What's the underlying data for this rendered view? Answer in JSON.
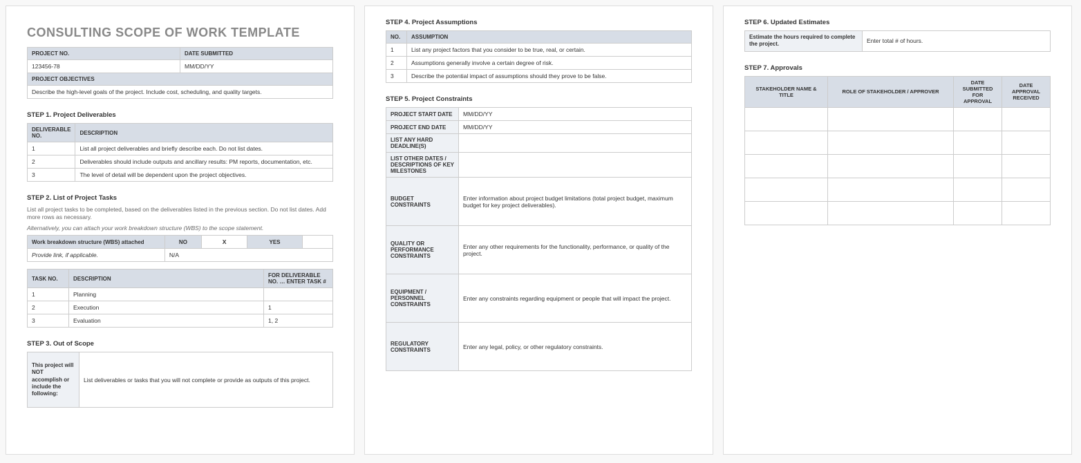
{
  "title": "CONSULTING SCOPE OF WORK TEMPLATE",
  "projectInfo": {
    "projectNoLabel": "PROJECT NO.",
    "dateSubmittedLabel": "DATE SUBMITTED",
    "projectNo": "123456-78",
    "dateSubmitted": "MM/DD/YY",
    "objectivesLabel": "PROJECT OBJECTIVES",
    "objectivesText": "Describe the high-level goals of the project.  Include cost, scheduling, and quality targets."
  },
  "step1": {
    "title": "STEP 1. Project Deliverables",
    "colNo": "DELIVERABLE NO.",
    "colDesc": "DESCRIPTION",
    "rows": [
      {
        "no": "1",
        "desc": "List all project deliverables and briefly describe each. Do not list dates."
      },
      {
        "no": "2",
        "desc": "Deliverables should include outputs and ancillary results: PM reports, documentation, etc."
      },
      {
        "no": "3",
        "desc": "The level of detail will be dependent upon the project objectives."
      }
    ]
  },
  "step2": {
    "title": "STEP 2. List of Project Tasks",
    "sub1": "List all project tasks to be completed, based on the deliverables listed in the previous section. Do not list dates. Add more rows as necessary.",
    "sub2": "Alternatively, you can attach your work breakdown structure (WBS) to the scope statement.",
    "wbsLabel": "Work breakdown structure (WBS) attached",
    "noLabel": "NO",
    "yesLabel": "YES",
    "xMark": "X",
    "linkLabel": "Provide link, if applicable.",
    "linkVal": "N/A",
    "colTask": "TASK NO.",
    "colDesc": "DESCRIPTION",
    "colDel": "FOR DELIVERABLE NO. … ENTER TASK #",
    "rows": [
      {
        "no": "1",
        "desc": "Planning",
        "del": ""
      },
      {
        "no": "2",
        "desc": "Execution",
        "del": "1"
      },
      {
        "no": "3",
        "desc": "Evaluation",
        "del": "1, 2"
      }
    ]
  },
  "step3": {
    "title": "STEP 3. Out of Scope",
    "label": "This project will NOT accomplish or include the following:",
    "text": "List deliverables or tasks that you will not complete or provide as outputs of this project."
  },
  "step4": {
    "title": "STEP 4. Project Assumptions",
    "colNo": "NO.",
    "colAssump": "ASSUMPTION",
    "rows": [
      {
        "no": "1",
        "desc": "List any project factors that you consider to be true, real, or certain."
      },
      {
        "no": "2",
        "desc": "Assumptions generally involve a certain degree of risk."
      },
      {
        "no": "3",
        "desc": "Describe the potential impact of assumptions should they prove to be false."
      }
    ]
  },
  "step5": {
    "title": "STEP 5. Project Constraints",
    "rows": [
      {
        "label": "PROJECT START DATE",
        "val": "MM/DD/YY",
        "tall": false
      },
      {
        "label": "PROJECT END DATE",
        "val": "MM/DD/YY",
        "tall": false
      },
      {
        "label": "LIST ANY HARD DEADLINE(S)",
        "val": "",
        "tall": false
      },
      {
        "label": "LIST OTHER DATES / DESCRIPTIONS OF KEY MILESTONES",
        "val": "",
        "tall": false
      },
      {
        "label": "BUDGET CONSTRAINTS",
        "val": "Enter information about project budget limitations (total project budget, maximum budget for key project deliverables).",
        "tall": true
      },
      {
        "label": "QUALITY OR PERFORMANCE CONSTRAINTS",
        "val": "Enter any other requirements for the functionality, performance, or quality of the project.",
        "tall": true
      },
      {
        "label": "EQUIPMENT / PERSONNEL CONSTRAINTS",
        "val": "Enter any constraints regarding equipment or people that will impact the project.",
        "tall": true
      },
      {
        "label": "REGULATORY CONSTRAINTS",
        "val": "Enter any legal, policy, or other regulatory constraints.",
        "tall": true
      }
    ]
  },
  "step6": {
    "title": "STEP 6. Updated Estimates",
    "label": "Estimate the hours required to complete the project.",
    "val": "Enter total # of hours."
  },
  "step7": {
    "title": "STEP 7. Approvals",
    "col1": "STAKEHOLDER NAME & TITLE",
    "col2": "ROLE OF STAKEHOLDER / APPROVER",
    "col3": "DATE SUBMITTED FOR APPROVAL",
    "col4": "DATE APPROVAL RECEIVED"
  }
}
